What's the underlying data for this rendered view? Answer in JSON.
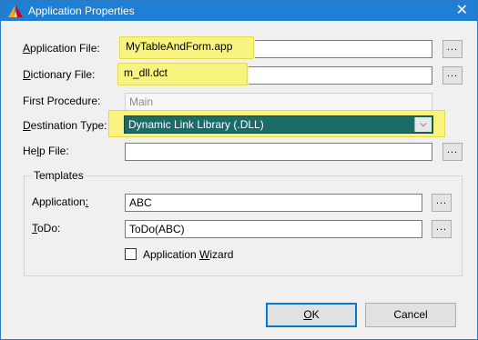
{
  "window": {
    "title": "Application Properties",
    "close_glyph": "✕",
    "title_icon": "app-icon"
  },
  "fields": {
    "application_file": {
      "label": "Application File:",
      "accel": "A",
      "rest": "pplication File:",
      "value": "MyTableAndForm.app",
      "button": "..."
    },
    "dictionary_file": {
      "label": "Dictionary File:",
      "accel": "D",
      "rest": "ictionary File:",
      "value": "m_dll.dct",
      "button": "..."
    },
    "first_procedure": {
      "label": "First Procedure:",
      "value": "Main"
    },
    "destination_type": {
      "label": "Destination Type:",
      "accel": "D",
      "rest": "estination Type:",
      "value": "Dynamic Link Library (.DLL)",
      "arrow": "⌵"
    },
    "help_file": {
      "label": "Help File:",
      "pre": "He",
      "accel": "l",
      "rest": "p File:",
      "value": "",
      "button": "..."
    }
  },
  "templates": {
    "title": "Templates",
    "application": {
      "label": "Application:",
      "pre": "Application",
      "accel": ":",
      "rest": "",
      "value": "ABC",
      "button": "..."
    },
    "todo": {
      "label": "ToDo:",
      "pre": "",
      "accel": "T",
      "rest": "oDo:",
      "value": "ToDo(ABC)",
      "button": "..."
    },
    "wizard": {
      "label": "Application Wizard",
      "pre": "Application ",
      "accel": "W",
      "rest": "izard",
      "checked": false
    }
  },
  "buttons": {
    "ok": {
      "accel": "O",
      "rest": "K"
    },
    "cancel": "Cancel"
  },
  "colors": {
    "titlebar": "#1e7fd4",
    "highlight": "#f9f37f",
    "combo_selected": "#1c6b69",
    "default_button_border": "#0078d7"
  }
}
